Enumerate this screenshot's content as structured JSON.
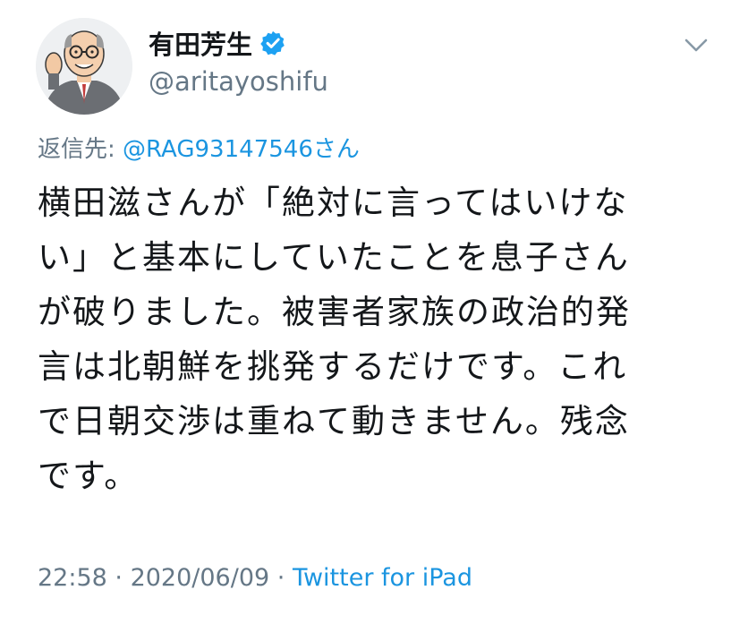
{
  "author": {
    "display_name": "有田芳生",
    "handle": "@aritayoshifu",
    "verified": true
  },
  "reply": {
    "prefix": "返信先: ",
    "to_handle": "@RAG93147546",
    "suffix": "さん"
  },
  "tweet": {
    "lines": [
      "横田滋さんが「絶対に言ってはいけな",
      "い」と基本にしていたことを息子さん",
      "が破りました。被害者家族の政治的発",
      "言は北朝鮮を挑発するだけです。これ",
      "で日朝交渉は重ねて動きません。残念",
      "です。"
    ]
  },
  "meta": {
    "time": "22:58",
    "separator1": " · ",
    "date": "2020/06/09",
    "separator2": " · ",
    "source": "Twitter for iPad"
  },
  "colors": {
    "link": "#1b95e0",
    "secondary_text": "#657786",
    "primary_text": "#14171a",
    "verified_badge": "#1da1f2"
  },
  "icons": {
    "verified": "verified-badge-icon",
    "more": "chevron-down-icon"
  }
}
